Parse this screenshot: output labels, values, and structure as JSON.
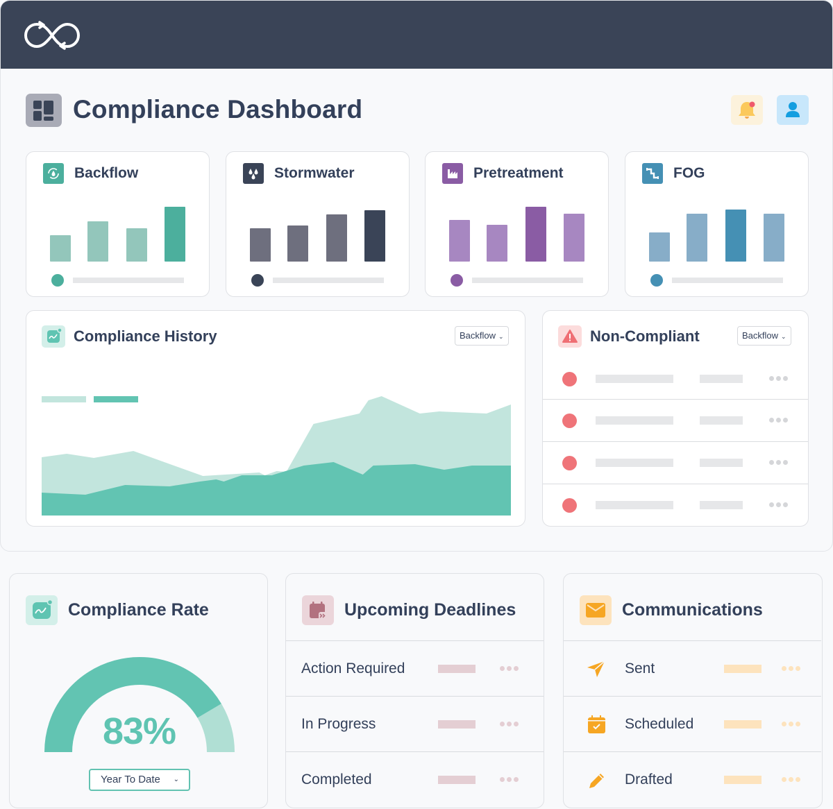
{
  "header": {
    "logo_icon": "infinity-recycle-logo-icon",
    "page_title": "Compliance Dashboard",
    "title_icon": "dashboard-grid-icon",
    "notification_icon": "bell-icon",
    "notification_has_unread": true,
    "user_icon": "user-icon"
  },
  "colors": {
    "topbar": "#3a4457",
    "teal": "#4caf9d",
    "slate": "#3a4457",
    "purple": "#8a5ca4",
    "blue": "#4590b4",
    "danger": "#ef7479",
    "amber": "#f6a623"
  },
  "program_cards": [
    {
      "title": "Backflow",
      "icon": "backflow-recycle-drop-icon",
      "accent": "#4caf9d",
      "icon_bg": "#4caf9d",
      "bar_light": "#93c6bb",
      "values": [
        38,
        58,
        48,
        79
      ],
      "highlight_index": 3
    },
    {
      "title": "Stormwater",
      "icon": "raindrops-icon",
      "accent": "#3a4457",
      "icon_bg": "#3a4457",
      "bar_light": "#6e6f7e",
      "values": [
        48,
        52,
        68,
        74
      ],
      "highlight_index": 3
    },
    {
      "title": "Pretreatment",
      "icon": "factory-icon",
      "accent": "#8a5ca4",
      "icon_bg": "#8a5ca4",
      "bar_light": "#a787c1",
      "values": [
        60,
        53,
        79,
        69
      ],
      "highlight_index": 2
    },
    {
      "title": "FOG",
      "icon": "pipe-icon",
      "accent": "#4590b4",
      "icon_bg": "#4590b4",
      "bar_light": "#87adc8",
      "values": [
        42,
        69,
        75,
        69
      ],
      "highlight_index": 2
    }
  ],
  "compliance_history": {
    "title": "Compliance History",
    "icon": "trend-chart-icon",
    "filter_value": "Backflow",
    "chart_data": {
      "type": "area",
      "title": "Compliance History",
      "xlabel": "",
      "ylabel": "",
      "x": [
        0,
        36,
        75,
        132,
        232,
        252,
        283,
        321,
        338,
        361,
        380,
        391,
        418,
        457,
        475,
        490,
        537,
        544,
        572,
        619,
        635,
        675
      ],
      "ylim": [
        0,
        180
      ],
      "grid": false,
      "legend": "top-left",
      "series": [
        {
          "name": "",
          "color": "#c2e5dd",
          "points": [
            [
              0,
              84
            ],
            [
              36,
              89
            ],
            [
              75,
              83
            ],
            [
              132,
              93
            ],
            [
              232,
              57
            ],
            [
              313,
              62
            ],
            [
              321,
              58
            ],
            [
              338,
              64
            ],
            [
              352,
              63
            ],
            [
              391,
              132
            ],
            [
              457,
              147
            ],
            [
              470,
              166
            ],
            [
              489,
              172
            ],
            [
              544,
              147
            ],
            [
              572,
              150
            ],
            [
              640,
              147
            ],
            [
              675,
              160
            ]
          ]
        },
        {
          "name": "",
          "color": "#62c4b2",
          "points": [
            [
              0,
              33
            ],
            [
              63,
              30
            ],
            [
              120,
              44
            ],
            [
              184,
              42
            ],
            [
              228,
              49
            ],
            [
              251,
              52
            ],
            [
              262,
              49
            ],
            [
              288,
              58
            ],
            [
              331,
              58
            ],
            [
              377,
              72
            ],
            [
              420,
              77
            ],
            [
              462,
              59
            ],
            [
              477,
              72
            ],
            [
              537,
              74
            ],
            [
              579,
              66
            ],
            [
              619,
              72
            ],
            [
              675,
              72
            ]
          ]
        }
      ]
    }
  },
  "non_compliant": {
    "title": "Non-Compliant",
    "icon": "warning-triangle-icon",
    "filter_value": "Backflow",
    "rows": [
      {
        "status_icon": "status-dot-red"
      },
      {
        "status_icon": "status-dot-red"
      },
      {
        "status_icon": "status-dot-red"
      },
      {
        "status_icon": "status-dot-red"
      }
    ]
  },
  "compliance_rate": {
    "title": "Compliance Rate",
    "icon": "trend-chart-icon",
    "value_percent": 83,
    "value_label": "83%",
    "period": "Year To Date",
    "fill_color": "#62c4b2",
    "track_color": "#b0dfd4"
  },
  "upcoming_deadlines": {
    "title": "Upcoming Deadlines",
    "icon": "calendar-forward-icon",
    "rows": [
      {
        "label": "Action Required"
      },
      {
        "label": "In Progress"
      },
      {
        "label": "Completed"
      }
    ]
  },
  "communications": {
    "title": "Communications",
    "icon": "envelope-icon",
    "rows": [
      {
        "label": "Sent",
        "icon": "paper-plane-icon"
      },
      {
        "label": "Scheduled",
        "icon": "calendar-check-icon"
      },
      {
        "label": "Drafted",
        "icon": "pencil-icon"
      }
    ]
  }
}
